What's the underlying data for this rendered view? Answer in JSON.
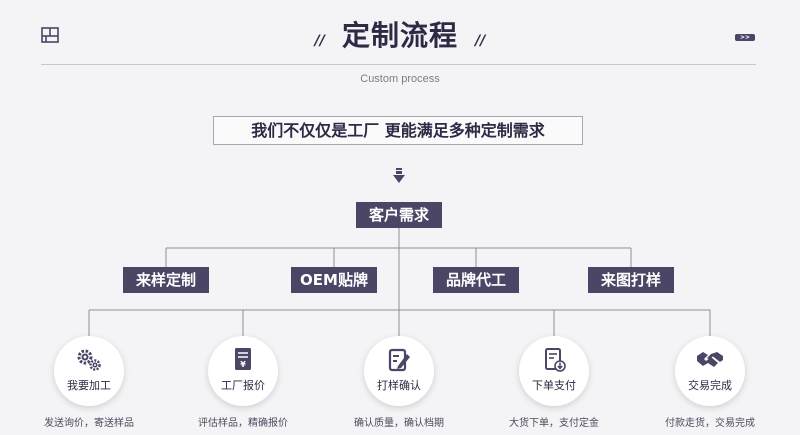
{
  "header": {
    "title": "定制流程",
    "slash_left": "//",
    "slash_right": "//",
    "subtitle": "Custom process",
    "more_label": ">>"
  },
  "tagline": "我们不仅仅是工厂  更能满足多种定制需求",
  "root": {
    "label": "客户需求"
  },
  "branches": [
    {
      "label": "来样定制"
    },
    {
      "label": "OEM贴牌"
    },
    {
      "label": "品牌代工"
    },
    {
      "label": "来图打样"
    }
  ],
  "steps": [
    {
      "label": "我要加工",
      "icon": "gears-icon",
      "desc": "发送询价，寄送样品"
    },
    {
      "label": "工厂报价",
      "icon": "price-document-icon",
      "desc": "评估样品，精确报价"
    },
    {
      "label": "打样确认",
      "icon": "edit-document-icon",
      "desc": "确认质量，确认档期"
    },
    {
      "label": "下单支付",
      "icon": "order-download-icon",
      "desc": "大货下单，支付定金"
    },
    {
      "label": "交易完成",
      "icon": "handshake-icon",
      "desc": "付款走货，交易完成"
    }
  ],
  "colors": {
    "accent": "#4b4566",
    "background": "#f4f4f6",
    "line": "#8f8ba0"
  }
}
